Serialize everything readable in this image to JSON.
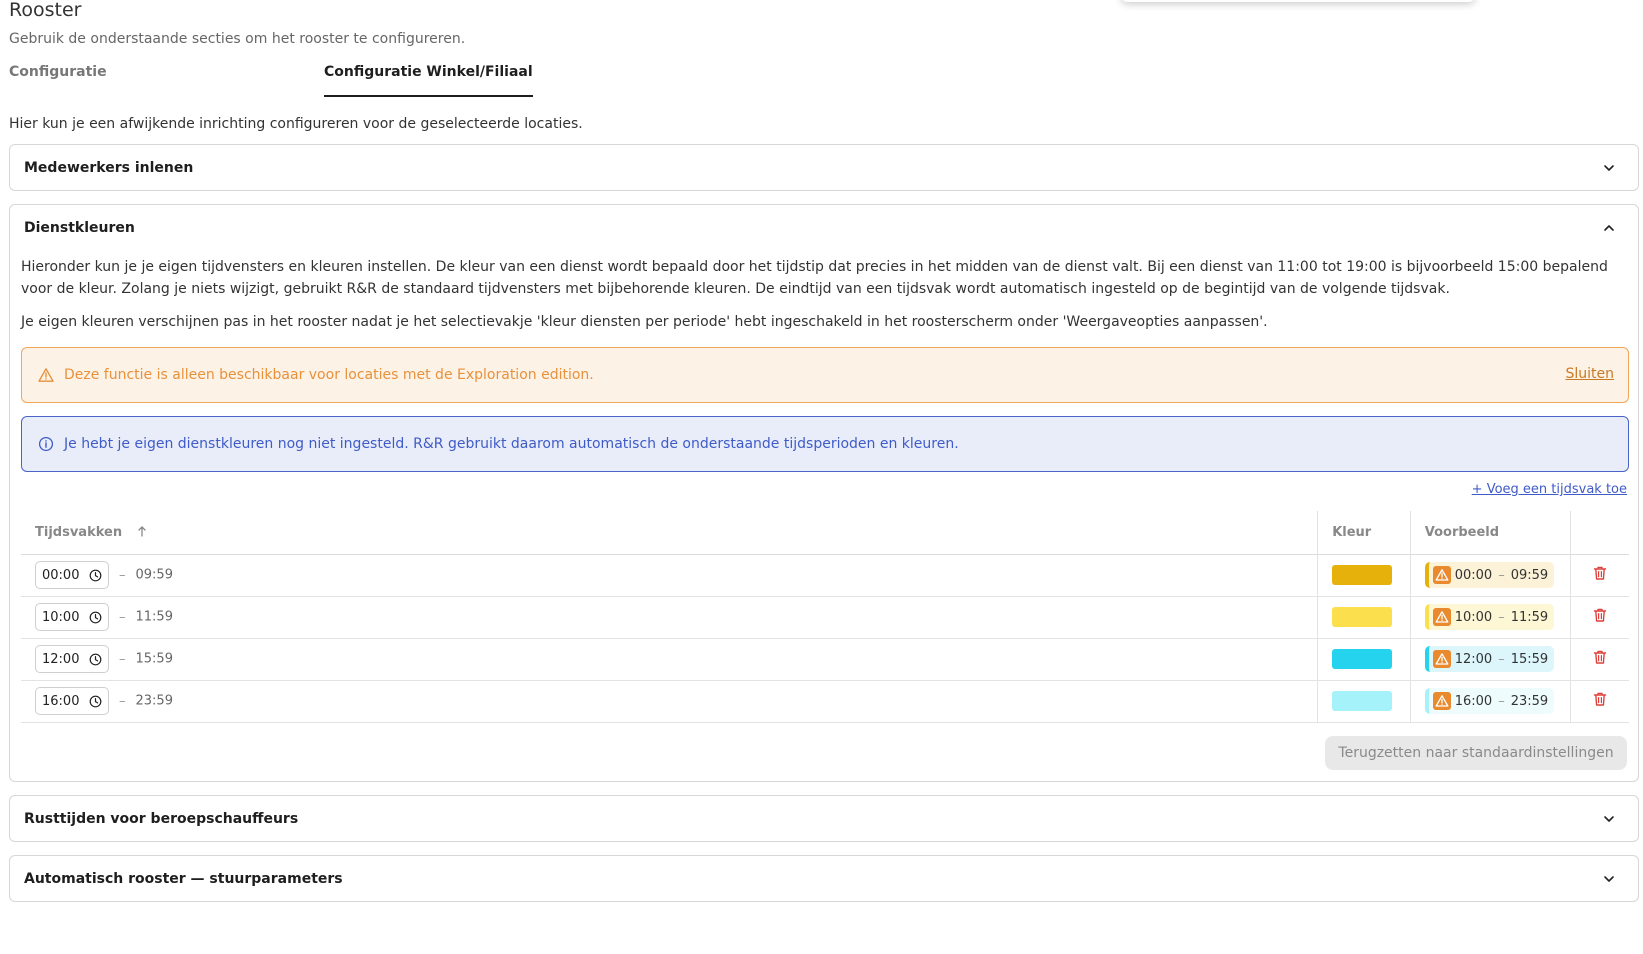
{
  "page": {
    "title": "Rooster",
    "subtitle": "Gebruik de onderstaande secties om het rooster te configureren.",
    "intro": "Hier kun je een afwijkende inrichting configureren voor de geselecteerde locaties."
  },
  "tabs": [
    {
      "label": "Configuratie",
      "active": false
    },
    {
      "label": "Configuratie Winkel/Filiaal",
      "active": true
    }
  ],
  "sections": {
    "employees": {
      "title": "Medewerkers inlenen",
      "expanded": false
    },
    "shift_colors": {
      "title": "Dienstkleuren",
      "expanded": true,
      "paragraph1": "Hieronder kun je je eigen tijdvensters en kleuren instellen. De kleur van een dienst wordt bepaald door het tijdstip dat precies in het midden van de dienst valt. Bij een dienst van 11:00 tot 19:00 is bijvoorbeeld 15:00 bepalend voor de kleur. Zolang je niets wijzigt, gebruikt R&R de standaard tijdvensters met bijbehorende kleuren. De eindtijd van een tijdsvak wordt automatisch ingesteld op de begintijd van de volgende tijdsvak.",
      "paragraph2": "Je eigen kleuren verschijnen pas in het rooster nadat je het selectievakje 'kleur diensten per periode' hebt ingeschakeld in het roosterscherm onder 'Weergaveopties aanpassen'.",
      "warning": {
        "text": "Deze functie is alleen beschikbaar voor locaties met de Exploration edition.",
        "close_label": "Sluiten"
      },
      "info": {
        "text": "Je hebt je eigen dienstkleuren nog niet ingesteld. R&R gebruikt daarom automatisch de onderstaande tijdsperioden en kleuren."
      },
      "add_label": "+ Voeg een tijdsvak toe",
      "columns": {
        "slots": "Tijdsvakken",
        "color": "Kleur",
        "preview": "Voorbeeld"
      },
      "rows": [
        {
          "start": "00:00",
          "end": "09:59",
          "color": "#e5b10a",
          "preview_bg": "#fcf2d8",
          "preview_border": "#e5b10a"
        },
        {
          "start": "10:00",
          "end": "11:59",
          "color": "#fbdf4c",
          "preview_bg": "#fdf7d6",
          "preview_border": "#fbdf4c"
        },
        {
          "start": "12:00",
          "end": "15:59",
          "color": "#25d3ee",
          "preview_bg": "#dcf6fc",
          "preview_border": "#25d3ee"
        },
        {
          "start": "16:00",
          "end": "23:59",
          "color": "#a5f2fa",
          "preview_bg": "#effcfe",
          "preview_border": "#a5f2fa"
        }
      ],
      "dash": "–",
      "reset_label": "Terugzetten naar standaardinstellingen"
    },
    "rest_times": {
      "title": "Rusttijden voor beroepschauffeurs",
      "expanded": false
    },
    "auto_schedule": {
      "title": "Automatisch rooster — stuurparameters",
      "expanded": false
    }
  },
  "icons": {
    "chevron": "chevron-icon",
    "warning": "warning-triangle-icon",
    "info": "info-circle-icon",
    "clock": "clock-icon",
    "trash": "trash-icon",
    "sort": "sort-arrow-icon"
  },
  "colors": {
    "accent_blue": "#3f5bc7",
    "warning_orange": "#e8913b",
    "delete_red": "#e0403a"
  }
}
